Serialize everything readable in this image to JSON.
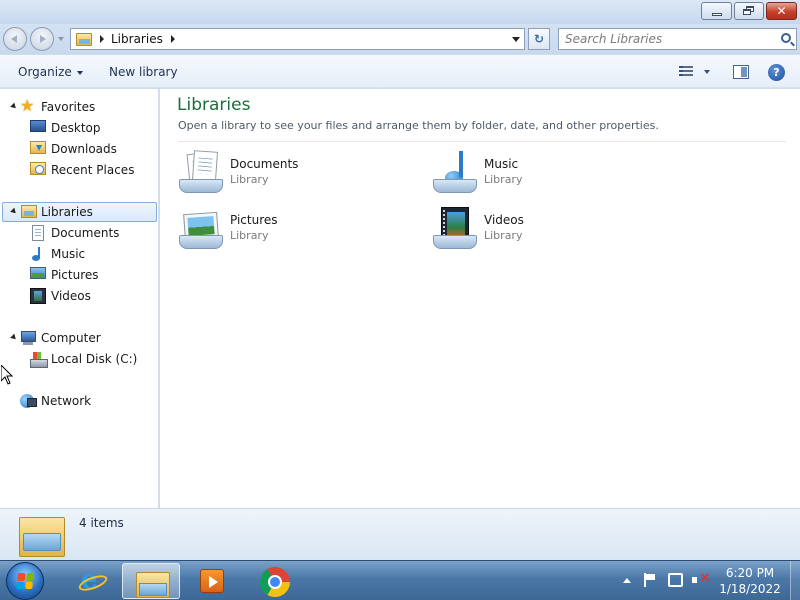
{
  "window": {
    "controls": {
      "minimize_icon": "minimize-icon",
      "maximize_icon": "restore-icon",
      "close_icon": "close-icon",
      "close_glyph": "✕"
    }
  },
  "address": {
    "breadcrumb": [
      "Libraries"
    ],
    "search_placeholder": "Search Libraries",
    "refresh_glyph": "↻"
  },
  "toolbar": {
    "organize_label": "Organize",
    "new_library_label": "New library",
    "help_glyph": "?"
  },
  "nav": {
    "favorites": {
      "label": "Favorites",
      "items": [
        {
          "label": "Desktop",
          "icon": "desktop-icon"
        },
        {
          "label": "Downloads",
          "icon": "downloads-icon"
        },
        {
          "label": "Recent Places",
          "icon": "recent-places-icon"
        }
      ]
    },
    "libraries": {
      "label": "Libraries",
      "items": [
        {
          "label": "Documents",
          "icon": "documents-icon"
        },
        {
          "label": "Music",
          "icon": "music-icon"
        },
        {
          "label": "Pictures",
          "icon": "pictures-icon"
        },
        {
          "label": "Videos",
          "icon": "videos-icon"
        }
      ]
    },
    "computer": {
      "label": "Computer",
      "items": [
        {
          "label": "Local Disk (C:)",
          "icon": "local-disk-icon"
        }
      ]
    },
    "network": {
      "label": "Network"
    }
  },
  "main": {
    "title": "Libraries",
    "description": "Open a library to see your files and arrange them by folder, date, and other properties.",
    "libraries": [
      {
        "name": "Documents",
        "type": "Library",
        "icon": "documents-library-icon"
      },
      {
        "name": "Music",
        "type": "Library",
        "icon": "music-library-icon"
      },
      {
        "name": "Pictures",
        "type": "Library",
        "icon": "pictures-library-icon"
      },
      {
        "name": "Videos",
        "type": "Library",
        "icon": "videos-library-icon"
      }
    ]
  },
  "details": {
    "count": "4 items"
  },
  "taskbar": {
    "pinned": [
      "internet-explorer-icon",
      "windows-explorer-icon",
      "windows-media-player-icon",
      "chrome-icon"
    ],
    "clock_time": "6:20 PM",
    "clock_date": "1/18/2022"
  },
  "colors": {
    "title_green": "#1e6e3c",
    "selection_border": "#84acdd",
    "taskbar": "#4b78a8"
  }
}
